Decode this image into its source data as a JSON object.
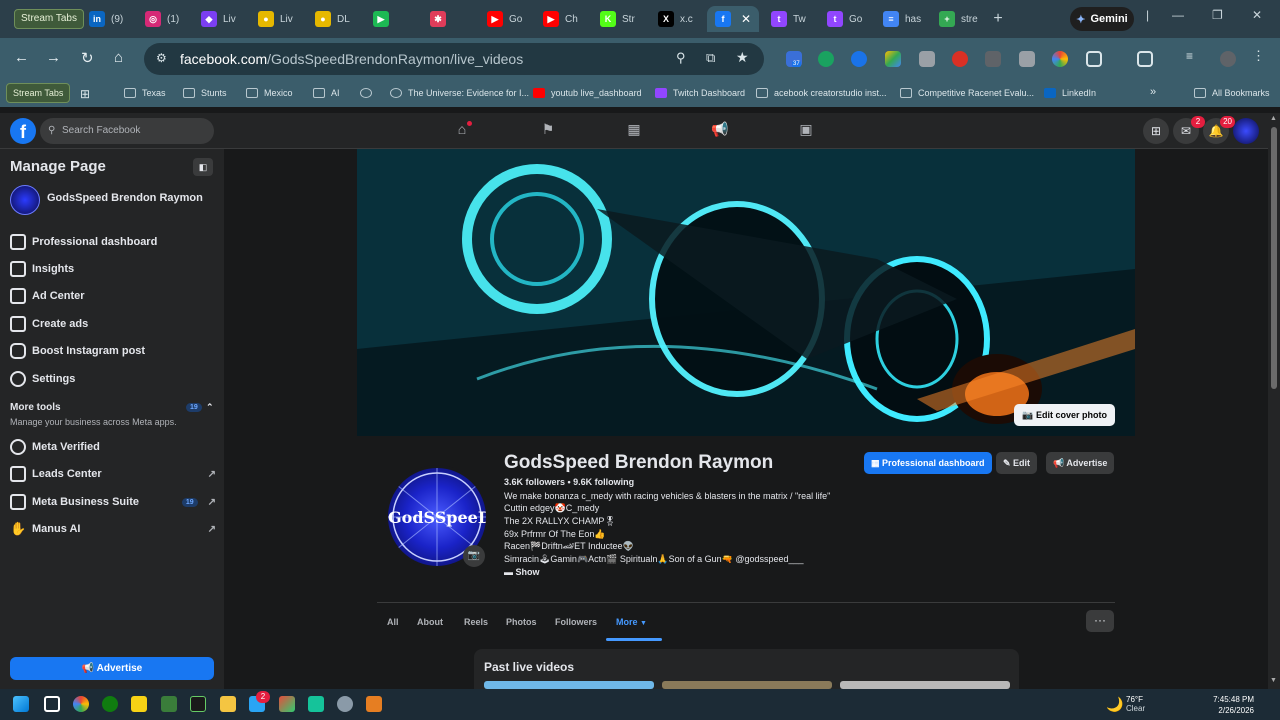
{
  "browser": {
    "stream_tabs_label": "Stream Tabs",
    "tabs": [
      {
        "label": "(9)",
        "color": "#0a66c2",
        "glyph": "in"
      },
      {
        "label": "(1)",
        "color": "#d62976",
        "glyph": "◎"
      },
      {
        "label": "Liv",
        "color": "#7b3ff2",
        "glyph": "◆"
      },
      {
        "label": "Liv",
        "color": "#e6b800",
        "glyph": "●"
      },
      {
        "label": "DL",
        "color": "#e6b800",
        "glyph": "●"
      },
      {
        "label": "",
        "color": "#1db954",
        "glyph": "▶"
      },
      {
        "label": "",
        "color": "#e03c5a",
        "glyph": "✱"
      },
      {
        "label": "Go",
        "color": "#ff0000",
        "glyph": "▶"
      },
      {
        "label": "Ch",
        "color": "#ff0000",
        "glyph": "▶"
      },
      {
        "label": "Str",
        "color": "#53fc18",
        "glyph": "K"
      },
      {
        "label": "x.c",
        "color": "#000000",
        "glyph": "X"
      },
      {
        "label": "",
        "color": "#1877f2",
        "glyph": "f"
      },
      {
        "label": "Tw",
        "color": "#9146ff",
        "glyph": "t"
      },
      {
        "label": "Go",
        "color": "#9146ff",
        "glyph": "t"
      },
      {
        "label": "has",
        "color": "#4285f4",
        "glyph": "≡"
      },
      {
        "label": "stre",
        "color": "#34a853",
        "glyph": "+"
      }
    ],
    "gemini_label": "Gemini",
    "url_domain": "facebook.com",
    "url_path": "/GodsSpeedBrendonRaymon/live_videos",
    "bookmarks": [
      {
        "label": "Texas"
      },
      {
        "label": "Stunts"
      },
      {
        "label": "Mexico"
      },
      {
        "label": "AI"
      },
      {
        "label": ""
      },
      {
        "label": "The Universe: Evidence for I..."
      },
      {
        "label": "youtub live_dashboard"
      },
      {
        "label": "Twitch Dashboard"
      },
      {
        "label": "acebook creatorstudio inst..."
      },
      {
        "label": "Competitive Racenet Evalu..."
      },
      {
        "label": "LinkedIn"
      }
    ],
    "all_bookmarks_label": "All Bookmarks",
    "ext_badge": "37"
  },
  "fb_header": {
    "search_placeholder": "Search Facebook",
    "messenger_badge": "2",
    "notifications_badge": "20"
  },
  "sidebar": {
    "title": "Manage Page",
    "page_name": "GodsSpeed Brendon Raymon",
    "items": [
      {
        "label": "Professional dashboard"
      },
      {
        "label": "Insights"
      },
      {
        "label": "Ad Center"
      },
      {
        "label": "Create ads"
      },
      {
        "label": "Boost Instagram post"
      },
      {
        "label": "Settings"
      }
    ],
    "more_tools_label": "More tools",
    "more_tools_count": "19",
    "more_tools_sub": "Manage your business across Meta apps.",
    "tools": [
      {
        "label": "Meta Verified"
      },
      {
        "label": "Leads Center"
      },
      {
        "label": "Meta Business Suite",
        "count": "19"
      },
      {
        "label": "Manus AI"
      }
    ],
    "advertise_label": "Advertise"
  },
  "profile": {
    "edit_cover_label": "Edit cover photo",
    "avatar_text": "GodSSpeeD",
    "name": "GodsSpeed Brendon Raymon",
    "stats": "3.6K followers • 9.6K following",
    "bio": [
      "We make bonanza c_medy with racing vehicles & blasters in the matrix / \"real life\"",
      "Cuttin edgey🤡C_medy",
      "The 2X RALLYX CHAMP🎖",
      "69x Prfrmr Of The Eon👍",
      "Racen🏁Driftn🏎ET Inductee👽",
      "Simracin🕹Gamin🎮Actn🎬 Spiritualn🙏Son of a Gun🔫 @godsspeed___"
    ],
    "show_label": "Show",
    "btn_dashboard": "Professional dashboard",
    "btn_edit": "Edit",
    "btn_advertise": "Advertise",
    "tabs": [
      "All",
      "About",
      "Reels",
      "Photos",
      "Followers",
      "More"
    ],
    "active_tab": "More",
    "section_title": "Past live videos"
  },
  "taskbar": {
    "temperature": "76°F",
    "condition": "Clear",
    "time": "7:45:48 PM",
    "date": "2/26/2026",
    "badge": "2"
  }
}
